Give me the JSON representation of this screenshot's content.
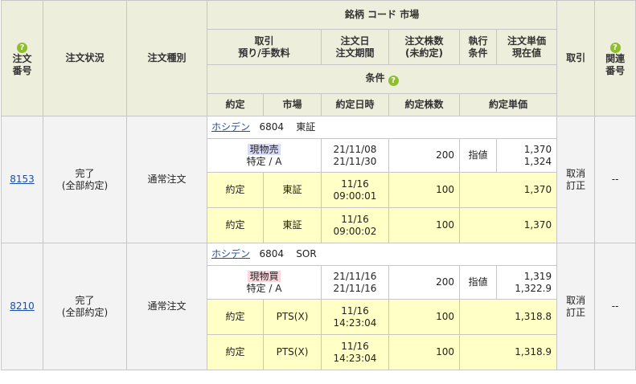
{
  "help_symbol": "?",
  "header": {
    "order_no": "注文番号",
    "status": "注文状況",
    "order_type": "注文種別",
    "symbol_market": "銘柄 コード 市場",
    "trade_fee": [
      "取引",
      "預り/手数料"
    ],
    "order_date_period": [
      "注文日",
      "注文期間"
    ],
    "order_qty": [
      "注文株数",
      "(未約定)"
    ],
    "exec_cond": [
      "執行",
      "条件"
    ],
    "price_current": [
      "注文単価",
      "現在値"
    ],
    "condition": "条件",
    "exec": "約定",
    "market": "市場",
    "exec_datetime": "約定日時",
    "exec_qty": "約定株数",
    "exec_price": "約定単価",
    "action": "取引",
    "related_no": [
      "関連",
      "番号"
    ]
  },
  "orders": [
    {
      "order_no": "8153",
      "status": [
        "完了",
        "(全部約定)"
      ],
      "order_type": "通常注文",
      "symbol": "ホシデン",
      "code": "6804",
      "market": "東証",
      "trade": "現物売",
      "account": "特定 / A",
      "order_date": "21/11/08",
      "order_period": "21/11/30",
      "qty": "200",
      "condition": "指値",
      "price": "1,370",
      "current": "1,324",
      "actions": [
        "取消",
        "訂正"
      ],
      "related": "--",
      "fills": [
        {
          "label": "約定",
          "market": "東証",
          "date": "11/16",
          "time": "09:00:01",
          "qty": "100",
          "price": "1,370"
        },
        {
          "label": "約定",
          "market": "東証",
          "date": "11/16",
          "time": "09:00:02",
          "qty": "100",
          "price": "1,370"
        }
      ]
    },
    {
      "order_no": "8210",
      "status": [
        "完了",
        "(全部約定)"
      ],
      "order_type": "通常注文",
      "symbol": "ホシデン",
      "code": "6804",
      "market": "SOR",
      "trade": "現物買",
      "account": "特定 / A",
      "order_date": "21/11/16",
      "order_period": "21/11/16",
      "qty": "200",
      "condition": "指値",
      "price": "1,319",
      "current": "1,322.9",
      "actions": [
        "取消",
        "訂正"
      ],
      "related": "--",
      "fills": [
        {
          "label": "約定",
          "market": "PTS(X)",
          "date": "11/16",
          "time": "14:23:04",
          "qty": "100",
          "price": "1,318.8"
        },
        {
          "label": "約定",
          "market": "PTS(X)",
          "date": "11/16",
          "time": "14:23:04",
          "qty": "100",
          "price": "1,318.9"
        }
      ]
    }
  ]
}
